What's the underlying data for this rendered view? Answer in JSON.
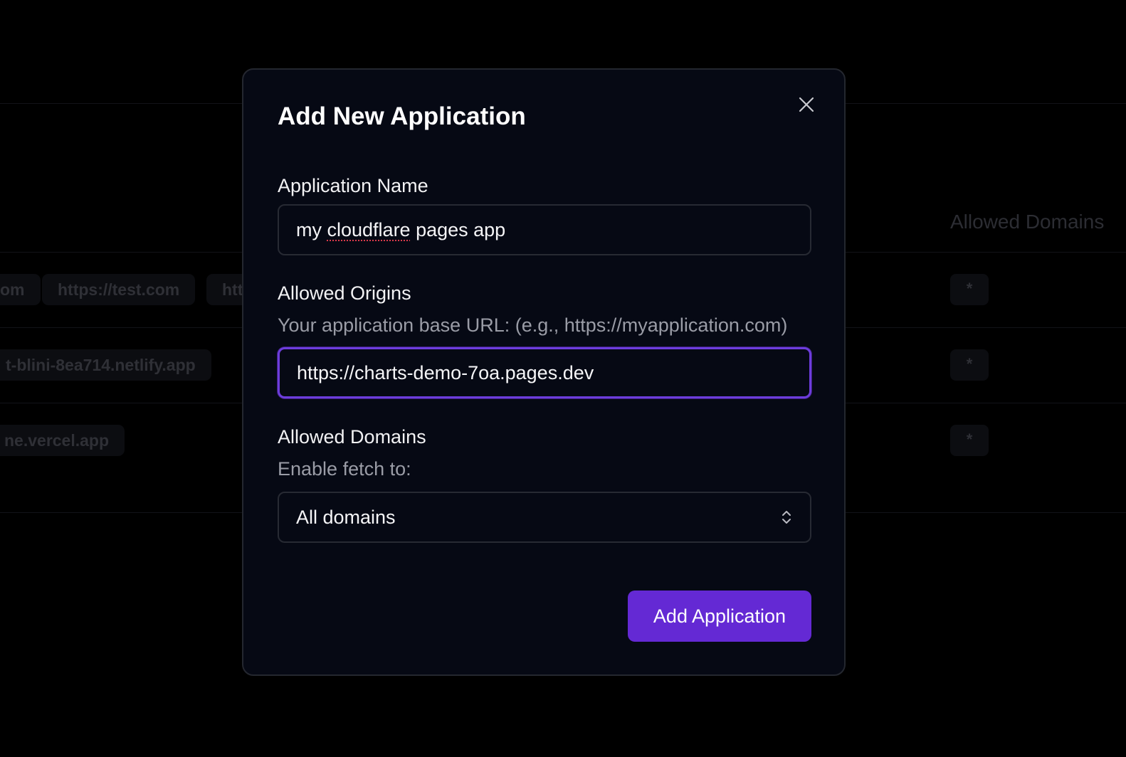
{
  "background": {
    "column_header": "Allowed Domains",
    "rows": [
      {
        "origins": [
          "om",
          "https://test.com",
          "htt"
        ],
        "domains": "*"
      },
      {
        "origins": [
          "t-blini-8ea714.netlify.app"
        ],
        "domains": "*"
      },
      {
        "origins": [
          "ne.vercel.app"
        ],
        "domains": "*"
      }
    ]
  },
  "modal": {
    "title": "Add New Application",
    "close_icon": "close-icon",
    "app_name": {
      "label": "Application Name",
      "value_prefix": "my ",
      "value_misspelled": "cloudflare",
      "value_suffix": " pages app"
    },
    "allowed_origins": {
      "label": "Allowed Origins",
      "helper": "Your application base URL: (e.g., https://myapplication.com)",
      "value": "https://charts-demo-7oa.pages.dev"
    },
    "allowed_domains": {
      "label": "Allowed Domains",
      "helper": "Enable fetch to:",
      "selected": "All domains",
      "chevron_icon": "chevron-up-down-icon"
    },
    "submit_label": "Add Application"
  },
  "colors": {
    "accent": "#6429d4",
    "focus_ring": "#6d3ddc",
    "modal_bg": "#060914",
    "page_bg": "#000000"
  }
}
